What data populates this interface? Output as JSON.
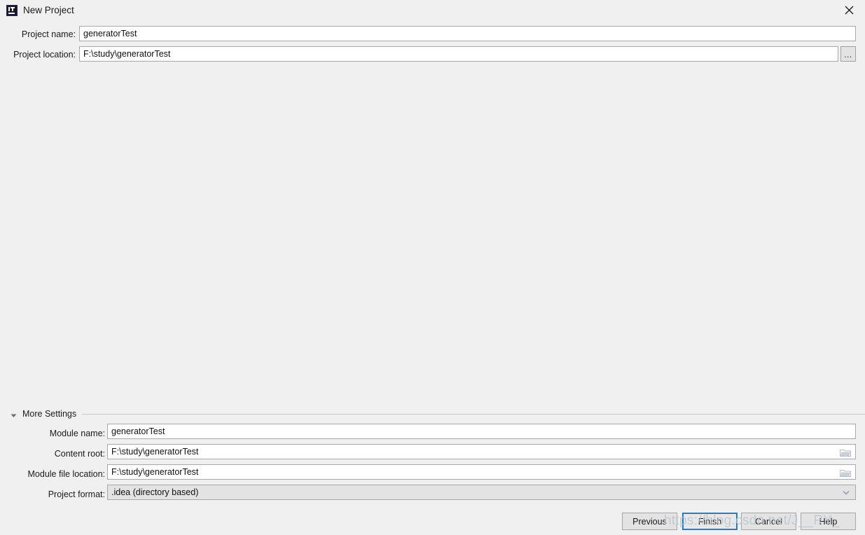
{
  "window": {
    "title": "New Project",
    "icon": "intellij-idea-icon",
    "close_label": "✕",
    "background_color": "#f0f0f0"
  },
  "top_form": {
    "rows": [
      {
        "label": "Project name:",
        "value": "generatorTest",
        "name": "project-name"
      },
      {
        "label": "Project location:",
        "value": "F:\\study\\generatorTest",
        "name": "project-location"
      }
    ],
    "browse_button_label": "..."
  },
  "more_settings": {
    "label": "More Settings",
    "expanded": true,
    "arrow_icon": "triangle-down-icon"
  },
  "bottom_form": {
    "rows": [
      {
        "label": "Module name:",
        "value": "generatorTest",
        "type": "text",
        "icon": "none"
      },
      {
        "label": "Content root:",
        "value": "F:\\study\\generatorTest",
        "type": "text",
        "icon": "folder-icon"
      },
      {
        "label": "Module file location:",
        "value": "F:\\study\\generatorTest",
        "type": "text",
        "icon": "folder-icon"
      },
      {
        "label": "Project format:",
        "value": ".idea (directory based)",
        "type": "combo",
        "icon": "chevron-down-icon"
      }
    ]
  },
  "buttons": [
    {
      "label": "Previous",
      "name": "previous-button",
      "primary": false
    },
    {
      "label": "Finish",
      "name": "finish-button",
      "primary": true
    },
    {
      "label": "Cancel",
      "name": "cancel-button",
      "primary": false
    },
    {
      "label": "Help",
      "name": "help-button",
      "primary": false
    }
  ],
  "watermark": {
    "text": "https://blog.csdn.net/J__RY_",
    "color": "#b9c3cc"
  }
}
